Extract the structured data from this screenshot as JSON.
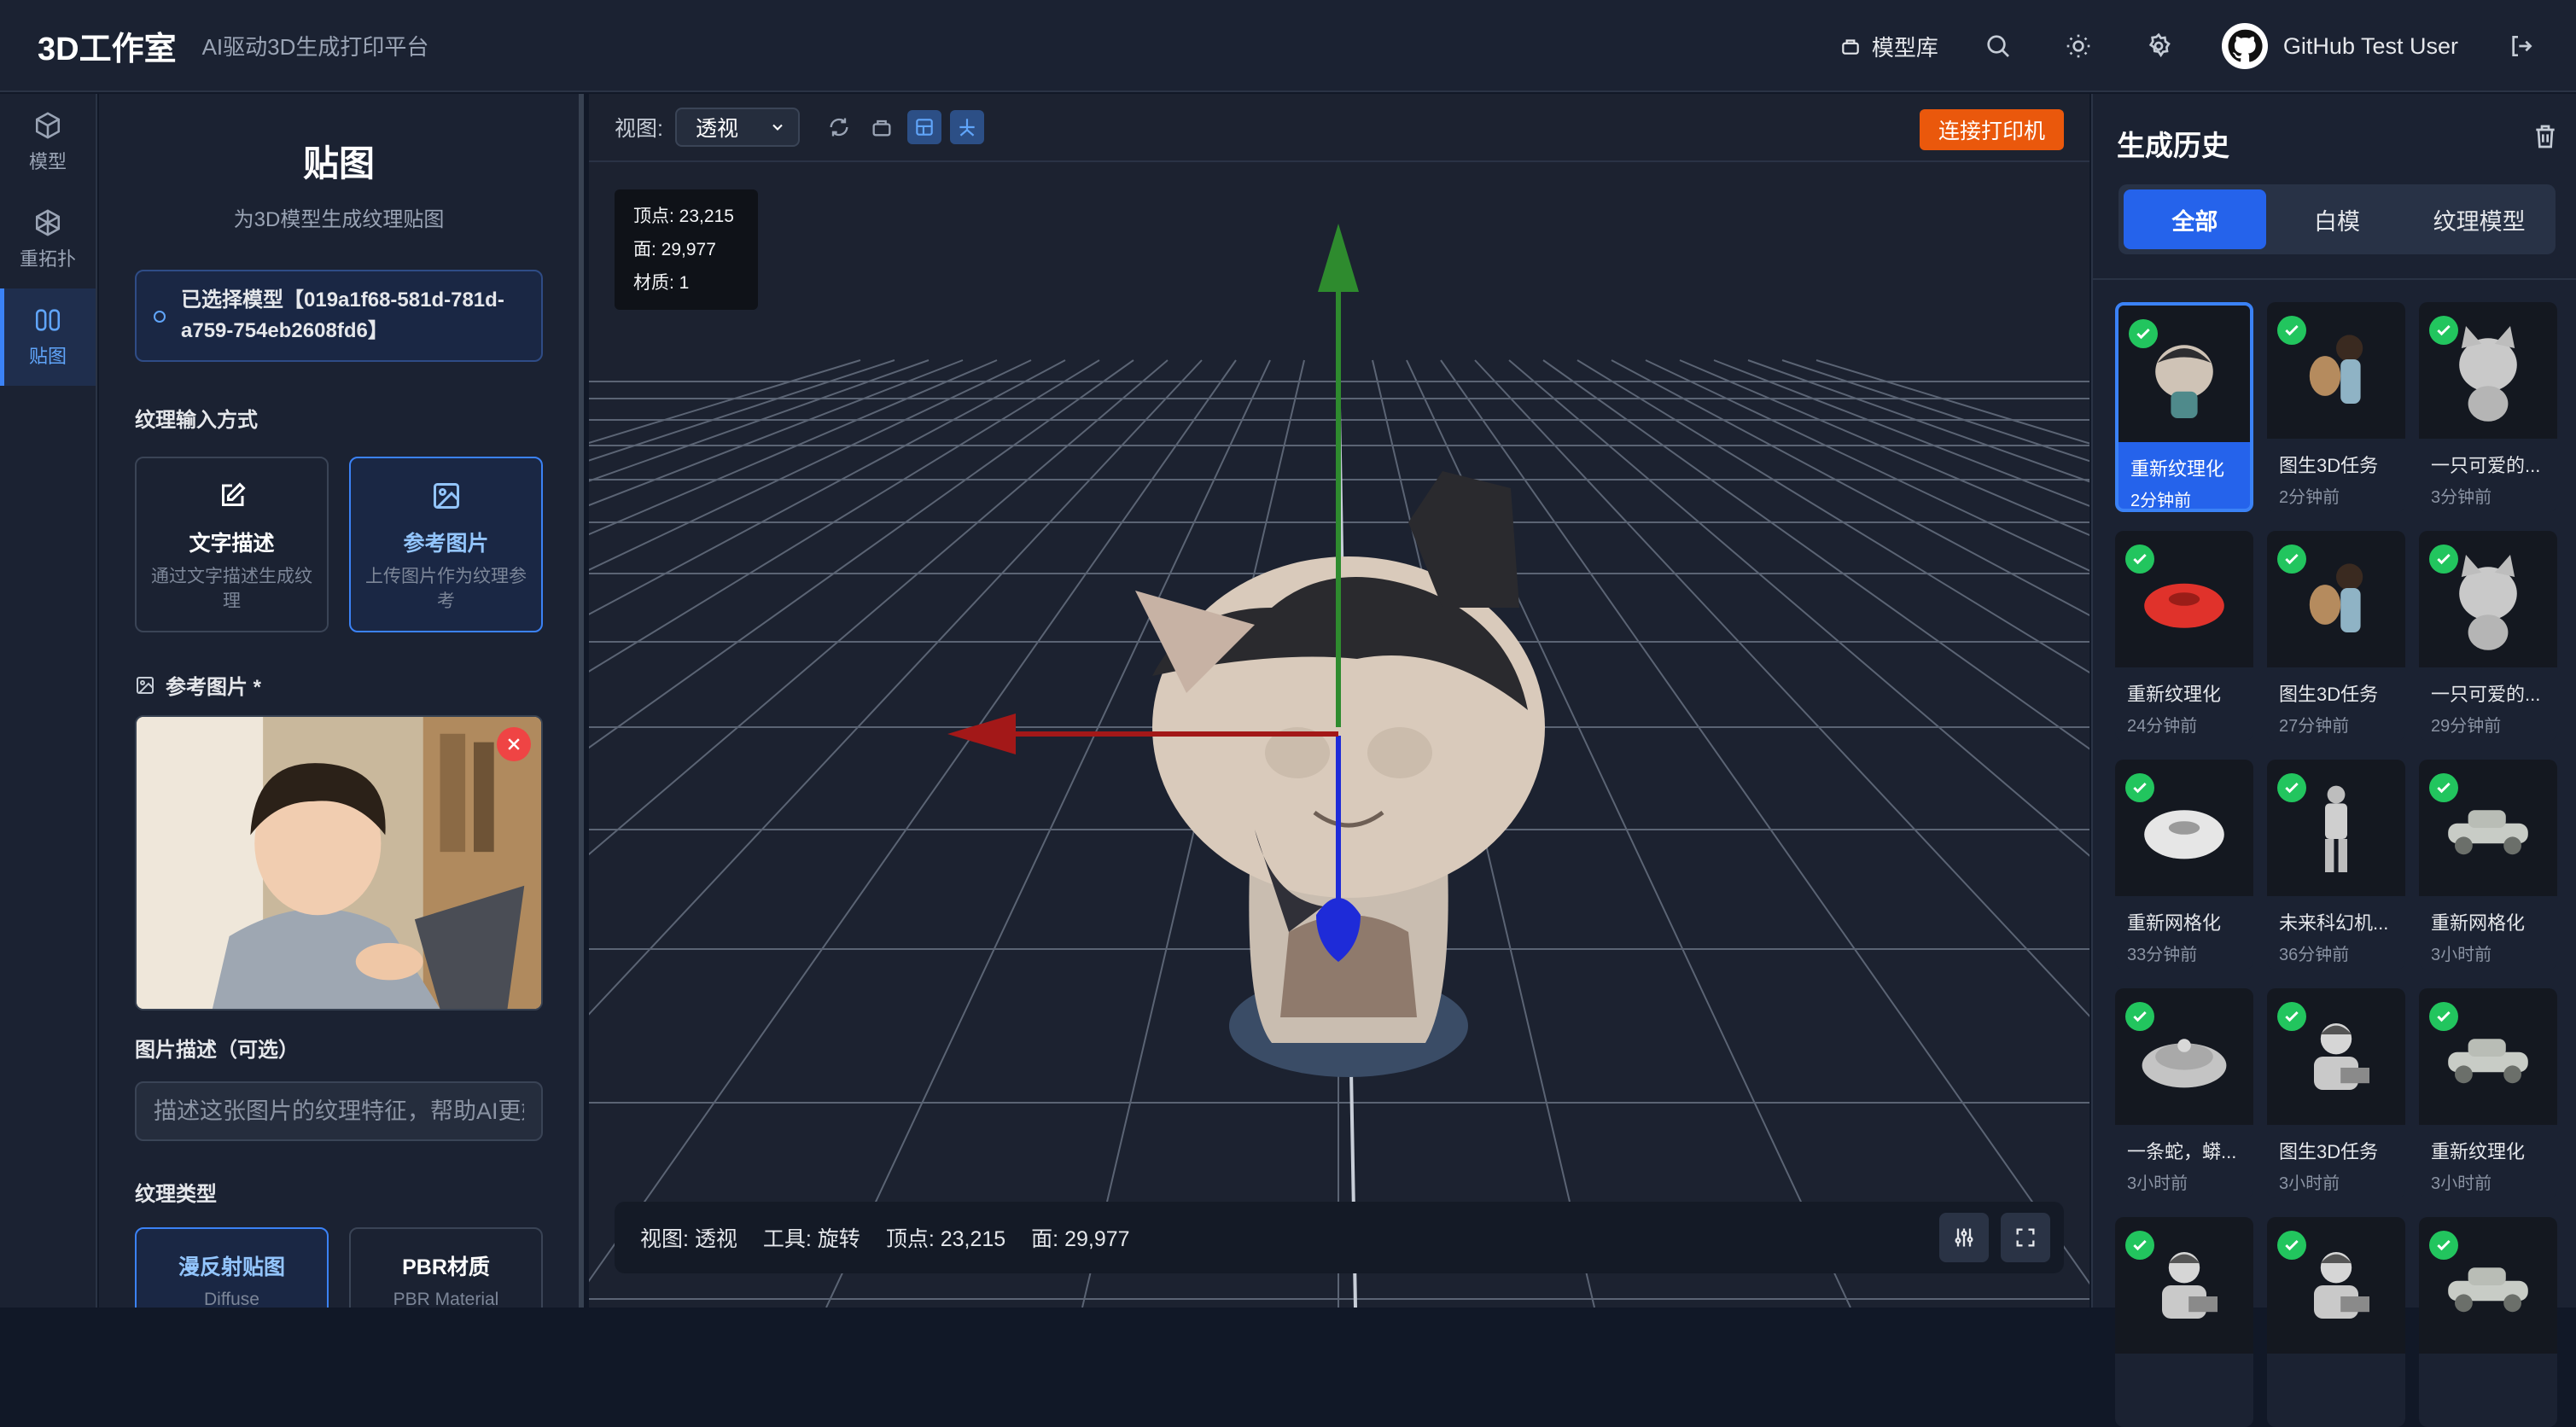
{
  "app": {
    "title": "3D工作室",
    "tagline": "AI驱动3D生成打印平台"
  },
  "header": {
    "model_library": "模型库",
    "user": "GitHub Test User",
    "icons": [
      "box-icon",
      "search-icon",
      "sun-icon",
      "gear-icon",
      "github-icon",
      "logout-icon"
    ]
  },
  "rail": {
    "items": [
      {
        "label": "模型",
        "icon": "cube-icon"
      },
      {
        "label": "重拓扑",
        "icon": "topology-icon"
      },
      {
        "label": "贴图",
        "icon": "texture-icon"
      }
    ]
  },
  "left": {
    "title": "贴图",
    "subtitle": "为3D模型生成纹理贴图",
    "selected_model": "已选择模型【019a1f68-581d-781d-a759-754eb2608fd6】",
    "input_method_label": "纹理输入方式",
    "methods": [
      {
        "title": "文字描述",
        "desc": "通过文字描述生成纹理"
      },
      {
        "title": "参考图片",
        "desc": "上传图片作为纹理参考"
      }
    ],
    "ref_label": "参考图片 *",
    "img_desc_label": "图片描述（可选）",
    "img_desc_placeholder": "描述这张图片的纹理特征，帮助AI更好地理解",
    "texture_type_label": "纹理类型",
    "types": [
      {
        "title": "漫反射贴图",
        "sub": "Diffuse"
      },
      {
        "title": "PBR材质",
        "sub": "PBR Material"
      }
    ]
  },
  "viewer": {
    "view_label": "视图:",
    "view_value": "透视",
    "connect_printer": "连接打印机",
    "stats": {
      "vertices": "顶点: 23,215",
      "faces": "面: 29,977",
      "materials": "材质: 1"
    },
    "status": {
      "view": "视图: 透视",
      "tool": "工具: 旋转",
      "vertices": "顶点: 23,215",
      "faces": "面: 29,977"
    }
  },
  "history": {
    "title": "生成历史",
    "tabs": [
      "全部",
      "白模",
      "纹理模型"
    ],
    "items": [
      {
        "name": "重新纹理化",
        "time": "2分钟前"
      },
      {
        "name": "图生3D任务",
        "time": "2分钟前"
      },
      {
        "name": "一只可爱的...",
        "time": "3分钟前"
      },
      {
        "name": "重新纹理化",
        "time": "24分钟前"
      },
      {
        "name": "图生3D任务",
        "time": "27分钟前"
      },
      {
        "name": "一只可爱的...",
        "time": "29分钟前"
      },
      {
        "name": "重新网格化",
        "time": "33分钟前"
      },
      {
        "name": "未来科幻机...",
        "time": "36分钟前"
      },
      {
        "name": "重新网格化",
        "time": "3小时前"
      },
      {
        "name": "一条蛇，蟒...",
        "time": "3小时前"
      },
      {
        "name": "图生3D任务",
        "time": "3小时前"
      },
      {
        "name": "重新纹理化",
        "time": "3小时前"
      },
      {
        "name": "",
        "time": ""
      },
      {
        "name": "",
        "time": ""
      },
      {
        "name": "",
        "time": ""
      }
    ]
  },
  "colors": {
    "accent": "#3b82f6",
    "printer": "#ea580c",
    "success": "#22c55e",
    "danger": "#ef4444"
  }
}
